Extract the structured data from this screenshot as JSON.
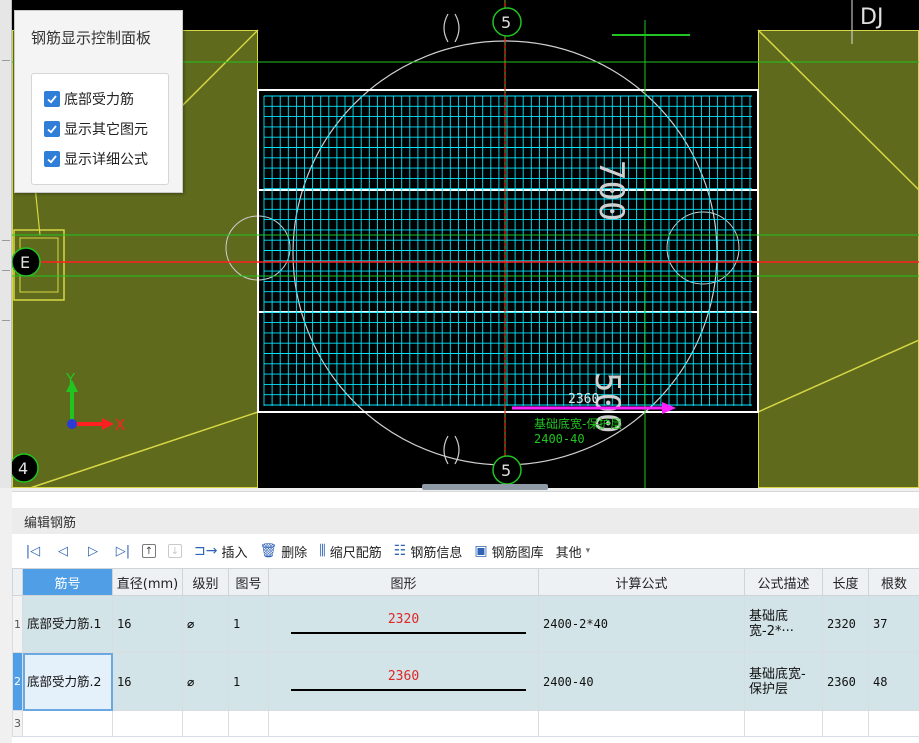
{
  "control_panel": {
    "title": "钢筋显示控制面板",
    "options": [
      {
        "label": "底部受力筋",
        "checked": true
      },
      {
        "label": "显示其它图元",
        "checked": true
      },
      {
        "label": "显示详细公式",
        "checked": true
      }
    ]
  },
  "cad": {
    "axis_top": "5",
    "axis_bottom": "5",
    "axis_left": "E",
    "axis_corner": "4",
    "top_right_label": "DJ",
    "dim_right_top": "700",
    "dim_right_bottom": "500",
    "rebar_length": "2360",
    "rebar_formula_line1": "基础底宽-保护层",
    "rebar_formula_line2": "2400-40",
    "axis_y": "Y",
    "axis_x": "X"
  },
  "editor": {
    "title": "编辑钢筋",
    "toolbar": {
      "insert": "插入",
      "delete": "删除",
      "scale_rebar": "缩尺配筋",
      "rebar_info": "钢筋信息",
      "rebar_library": "钢筋图库",
      "other": "其他"
    },
    "columns": [
      "筋号",
      "直径(mm)",
      "级别",
      "图号",
      "图形",
      "计算公式",
      "公式描述",
      "长度",
      "根数"
    ],
    "rows": [
      {
        "row_no": "1",
        "name": "底部受力筋.1",
        "diameter": "16",
        "grade": "⌀",
        "figure_no": "1",
        "shape_value": "2320",
        "formula": "2400-2*40",
        "description": "基础底宽-2*···",
        "length": "2320",
        "count": "37"
      },
      {
        "row_no": "2",
        "name": "底部受力筋.2",
        "diameter": "16",
        "grade": "⌀",
        "figure_no": "1",
        "shape_value": "2360",
        "formula": "2400-40",
        "description": "基础底宽-保护层",
        "length": "2360",
        "count": "48"
      },
      {
        "row_no": "3"
      }
    ]
  },
  "colors": {
    "accent": "#4f9ee6",
    "row_bg": "#d3e4e8",
    "shape_value": "#e02525",
    "mesh": "#00e5ff",
    "footing_fill": "#5f6a1c",
    "axis_red": "#ff2020",
    "axis_green": "#21c421"
  }
}
